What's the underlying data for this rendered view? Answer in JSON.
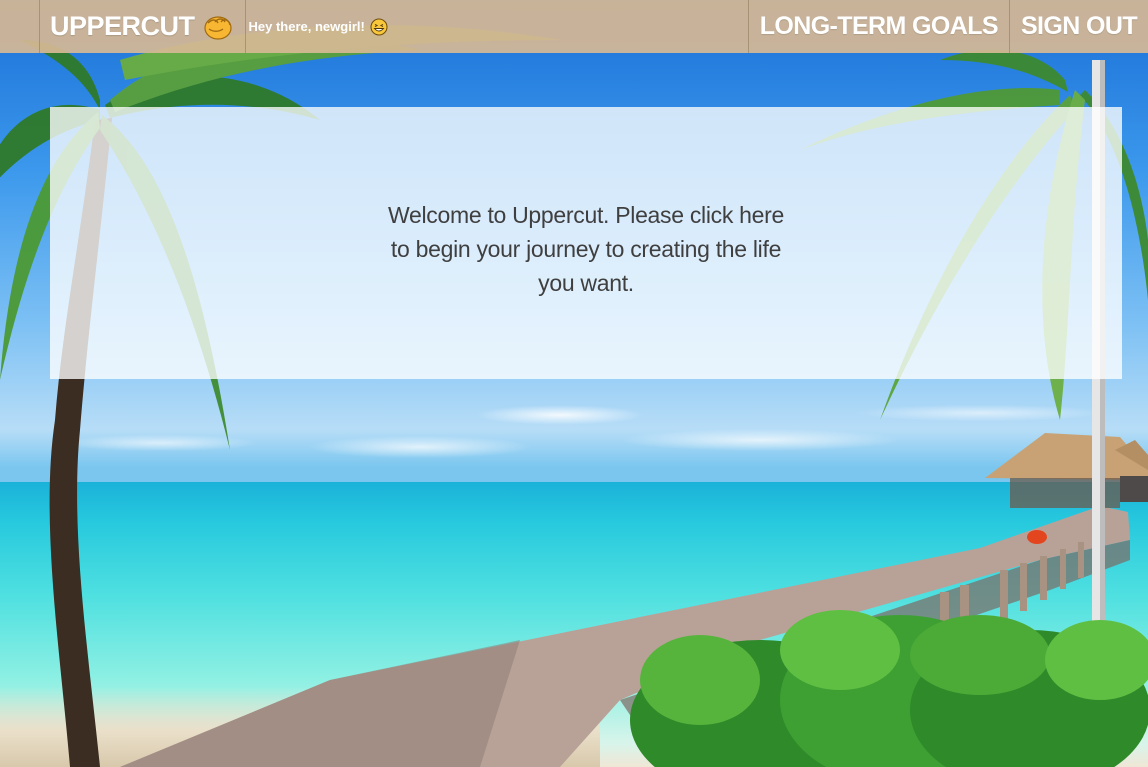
{
  "header": {
    "brand_label": "UPPERCUT",
    "brand_icon": "fist-icon",
    "greeting_text": "Hey there, newgirl!",
    "greeting_icon": "grinning-face-icon",
    "nav": [
      {
        "label": "LONG-TERM GOALS"
      },
      {
        "label": "SIGN OUT"
      }
    ],
    "bar_color": "#d5b894"
  },
  "main": {
    "welcome_text": "Welcome to Uppercut. Please click here to begin your journey to creating the life you want."
  },
  "background": {
    "scene": "tropical-beach-with-pier-and-palm-trees"
  }
}
